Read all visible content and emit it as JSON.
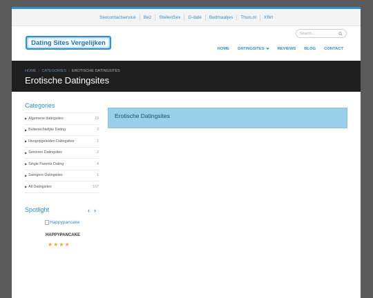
{
  "topbar": {
    "links": [
      "Sexcontactservice",
      "Be2",
      "StellenSex",
      "D-date",
      "Bedmaatjes",
      "Thuis.nl",
      "Xflirt"
    ]
  },
  "header": {
    "logo_text": "Dating Sites Vergelijken",
    "search_placeholder": "Search...",
    "nav": [
      {
        "label": "HOME"
      },
      {
        "label": "DATINGSITES"
      },
      {
        "label": "REVIEWS"
      },
      {
        "label": "BLOG"
      },
      {
        "label": "CONTACT"
      }
    ]
  },
  "banner": {
    "breadcrumb": [
      "HOME",
      "CATEGORIES",
      "EROTISCHE DATINGSITES"
    ],
    "title": "Erotische Datingsites"
  },
  "sidebar": {
    "categories_title": "Categories",
    "categories": [
      {
        "label": "Algemene datingsites",
        "count": "19"
      },
      {
        "label": "Buitenechtelijke Dating",
        "count": "3"
      },
      {
        "label": "Hoogopgeleiden Datingsites",
        "count": "1"
      },
      {
        "label": "Senioren Datingsites",
        "count": "2"
      },
      {
        "label": "Single Parents Dating",
        "count": "4"
      },
      {
        "label": "Swingers Datingsites",
        "count": "1"
      },
      {
        "label": "All Datingsites",
        "count": "157"
      }
    ],
    "spotlight_title": "Spotlight",
    "spotlight": {
      "image_alt": "Happypancake",
      "name": "HAPPYPANCAKE",
      "rating": 4
    }
  },
  "main": {
    "box_title": "Erotische Datingsites"
  },
  "colors": {
    "accent": "#2e8fd1",
    "banner_bg": "#1e1e1e",
    "box_bg": "#99cfea",
    "star": "#e8b01a"
  }
}
